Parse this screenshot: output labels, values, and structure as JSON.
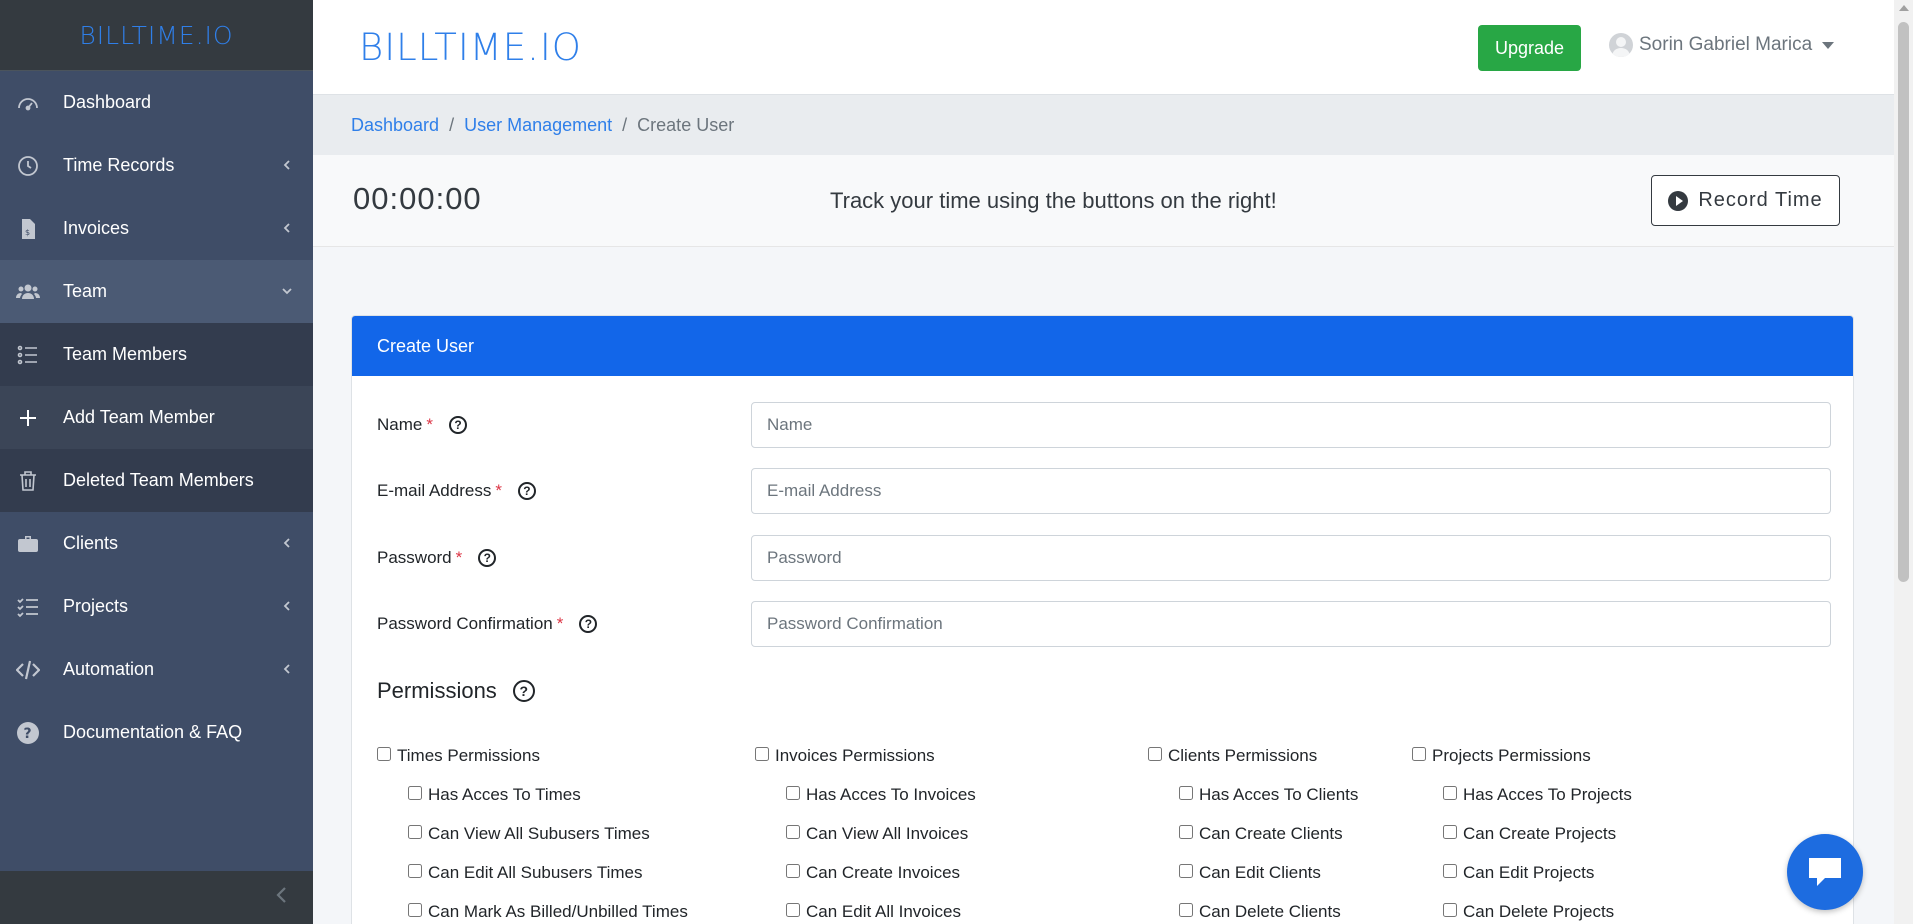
{
  "sidebar": {
    "brand": "BILLTIME.IO",
    "items": [
      {
        "label": "Dashboard",
        "icon": "tachometer-icon"
      },
      {
        "label": "Time Records",
        "icon": "clock-icon"
      },
      {
        "label": "Invoices",
        "icon": "invoice-icon"
      },
      {
        "label": "Team",
        "icon": "users-icon"
      },
      {
        "label": "Team Members",
        "icon": "list-icon"
      },
      {
        "label": "Add Team Member",
        "icon": "plus-icon"
      },
      {
        "label": "Deleted Team Members",
        "icon": "trash-icon"
      },
      {
        "label": "Clients",
        "icon": "briefcase-icon"
      },
      {
        "label": "Projects",
        "icon": "tasks-icon"
      },
      {
        "label": "Automation",
        "icon": "code-icon"
      },
      {
        "label": "Documentation & FAQ",
        "icon": "question-circle-icon"
      }
    ]
  },
  "topbar": {
    "logo": "BILLTIME.IO",
    "upgrade_label": "Upgrade",
    "user_name": "Sorin Gabriel Marica"
  },
  "breadcrumb": {
    "items": [
      "Dashboard",
      "User Management"
    ],
    "active": "Create User",
    "sep": "/"
  },
  "timer": {
    "value": "00:00:00",
    "message": "Track your time using the buttons on the right!",
    "record_label": "Record Time"
  },
  "form": {
    "title": "Create User",
    "fields": [
      {
        "label": "Name",
        "placeholder": "Name"
      },
      {
        "label": "E-mail Address",
        "placeholder": "E-mail Address"
      },
      {
        "label": "Password",
        "placeholder": "Password"
      },
      {
        "label": "Password Confirmation",
        "placeholder": "Password Confirmation"
      }
    ],
    "required_mark": "*",
    "help_mark": "?",
    "permissions_title": "Permissions",
    "permissions": [
      {
        "group": "Times Permissions",
        "items": [
          "Has Acces To Times",
          "Can View All Subusers Times",
          "Can Edit All Subusers Times",
          "Can Mark As Billed/Unbilled Times"
        ]
      },
      {
        "group": "Invoices Permissions",
        "items": [
          "Has Acces To Invoices",
          "Can View All Invoices",
          "Can Create Invoices",
          "Can Edit All Invoices"
        ]
      },
      {
        "group": "Clients Permissions",
        "items": [
          "Has Acces To Clients",
          "Can Create Clients",
          "Can Edit Clients",
          "Can Delete Clients"
        ]
      },
      {
        "group": "Projects Permissions",
        "items": [
          "Has Acces To Projects",
          "Can Create Projects",
          "Can Edit Projects",
          "Can Delete Projects"
        ]
      }
    ]
  },
  "colors": {
    "primary": "#1266e9",
    "brand": "#2f7fe9",
    "success": "#28a745",
    "sidebar": "#3f4d67"
  }
}
